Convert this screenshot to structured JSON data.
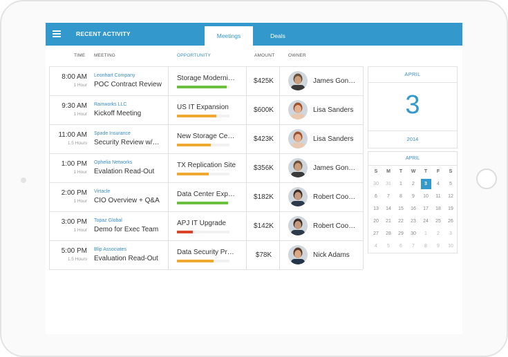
{
  "header": {
    "title": "RECENT ACTIVITY"
  },
  "tabs": [
    {
      "label": "Meetings",
      "active": true
    },
    {
      "label": "Deals",
      "active": false
    }
  ],
  "columns": {
    "time": "TIME",
    "meeting": "MEETING",
    "opportunity": "OPPORTUNITY",
    "amount": "AMOUNT",
    "owner": "OWNER"
  },
  "rows": [
    {
      "time": "8:00 AM",
      "duration": "1 Hour",
      "company": "Leonhart Company",
      "meeting": "POC Contract Review",
      "opportunity": "Storage Moderni…",
      "progress": 0.95,
      "bar_color": "#6cbf3f",
      "amount": "$425K",
      "owner": "James Gon…"
    },
    {
      "time": "9:30 AM",
      "duration": "1 Hour",
      "company": "Rainworks LLC",
      "meeting": "Kickoff Meeting",
      "opportunity": "US IT Expansion",
      "progress": 0.75,
      "bar_color": "#f0a930",
      "amount": "$600K",
      "owner": "Lisa Sanders"
    },
    {
      "time": "11:00 AM",
      "duration": "1.5 Hours",
      "company": "Spade Insurance",
      "meeting": "Security Review w/…",
      "opportunity": "New Storage Ce…",
      "progress": 0.65,
      "bar_color": "#f0a930",
      "amount": "$423K",
      "owner": "Lisa Sanders"
    },
    {
      "time": "1:00 PM",
      "duration": "1 Hour",
      "company": "Ophelia Networks",
      "meeting": "Evalation Read-Out",
      "opportunity": "TX Replication Site",
      "progress": 0.6,
      "bar_color": "#f0a930",
      "amount": "$356K",
      "owner": "James Gon…"
    },
    {
      "time": "2:00 PM",
      "duration": "1 Hour",
      "company": "Virtacle",
      "meeting": "CIO Overview + Q&A",
      "opportunity": "Data Center Exp…",
      "progress": 0.97,
      "bar_color": "#6cbf3f",
      "amount": "$182K",
      "owner": "Robert Coo…"
    },
    {
      "time": "3:00 PM",
      "duration": "1 Hour",
      "company": "Topaz Global",
      "meeting": "Demo for Exec Team",
      "opportunity": "APJ IT Upgrade",
      "progress": 0.3,
      "bar_color": "#d9432b",
      "amount": "$142K",
      "owner": "Robert Coo…"
    },
    {
      "time": "5:00 PM",
      "duration": "1.5 Hours",
      "company": "Blip Associates",
      "meeting": "Evaluation Read-Out",
      "opportunity": "Data Security Pr…",
      "progress": 0.7,
      "bar_color": "#f0a930",
      "amount": "$78K",
      "owner": "Nick Adams"
    }
  ],
  "date_card": {
    "month": "APRIL",
    "day": "3",
    "year": "2014"
  },
  "calendar": {
    "month": "APRIL",
    "weekdays": [
      "S",
      "M",
      "T",
      "W",
      "T",
      "F",
      "S"
    ],
    "weeks": [
      [
        "30",
        "31",
        "1",
        "2",
        "3",
        "4",
        "5"
      ],
      [
        "6",
        "7",
        "8",
        "9",
        "10",
        "11",
        "12"
      ],
      [
        "13",
        "14",
        "15",
        "16",
        "17",
        "18",
        "19"
      ],
      [
        "20",
        "21",
        "22",
        "23",
        "24",
        "25",
        "26"
      ],
      [
        "27",
        "28",
        "29",
        "30",
        "1",
        "2",
        "3"
      ],
      [
        "4",
        "5",
        "6",
        "7",
        "8",
        "9",
        "10"
      ]
    ],
    "selected": "3"
  }
}
